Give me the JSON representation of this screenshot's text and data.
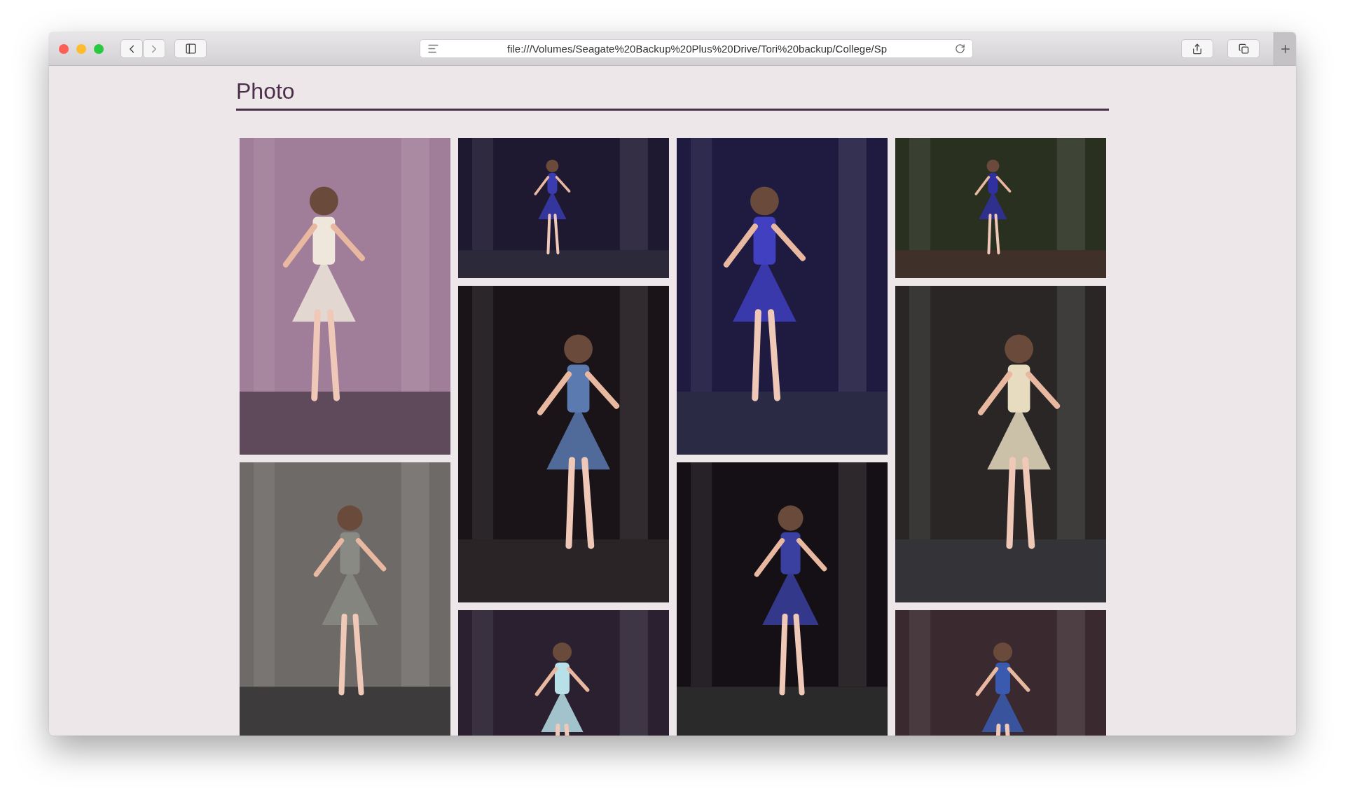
{
  "browser": {
    "url": "file:///Volumes/Seagate%20Backup%20Plus%20Drive/Tori%20backup/College/Sp"
  },
  "page": {
    "title": "Photo"
  }
}
